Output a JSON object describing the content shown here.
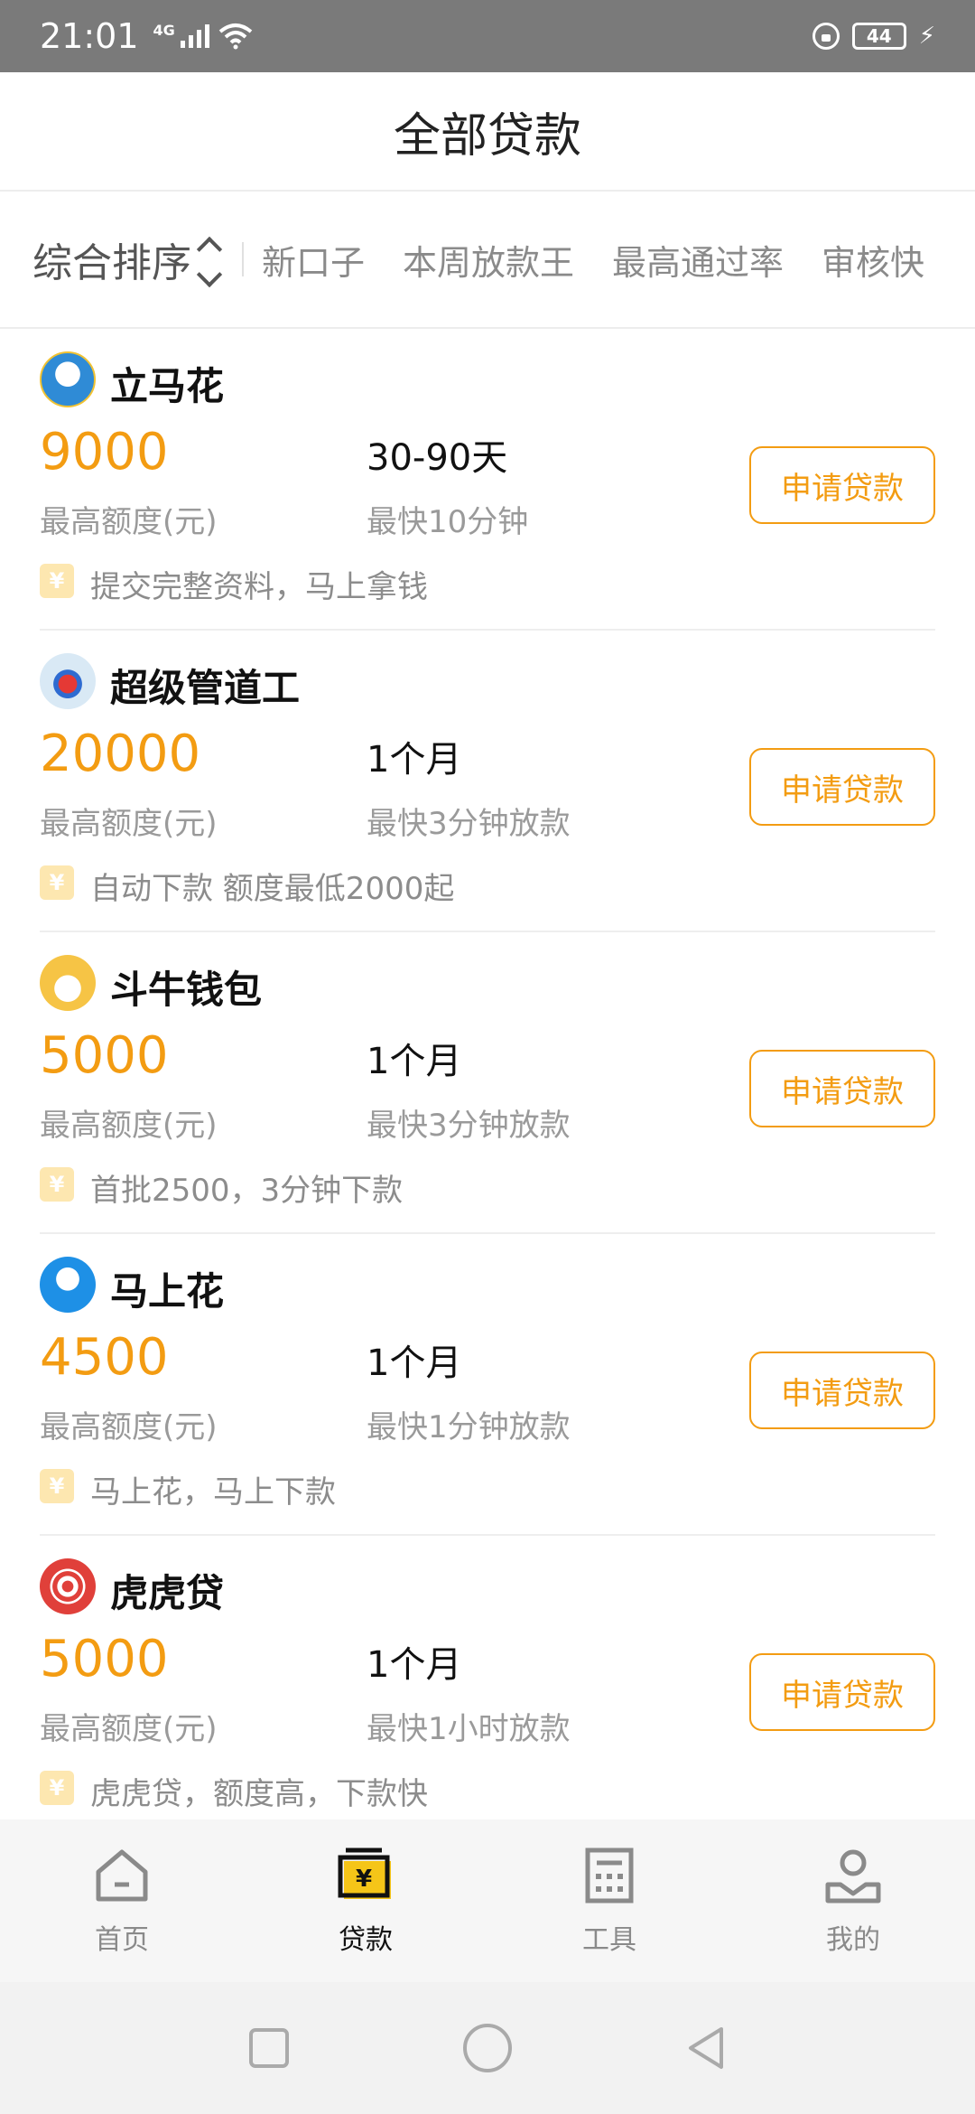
{
  "status_bar": {
    "time": "21:01",
    "network": "4G",
    "battery": "44"
  },
  "header": {
    "title": "全部贷款"
  },
  "filters": {
    "sort_label": "综合排序",
    "tabs": [
      "新口子",
      "本周放款王",
      "最高通过率",
      "审核快"
    ]
  },
  "loans": [
    {
      "name": "立马花",
      "amount": "9000",
      "amount_label": "最高额度(元)",
      "term": "30-90天",
      "speed": "最快10分钟",
      "button": "申请贷款",
      "tag": "提交完整资料，马上拿钱",
      "tag_icon": "¥",
      "logo_icon": "horse-logo-icon",
      "logo_color": "#2f8bd6"
    },
    {
      "name": "超级管道工",
      "amount": "20000",
      "amount_label": "最高额度(元)",
      "term": "1个月",
      "speed": "最快3分钟放款",
      "button": "申请贷款",
      "tag": "自动下款 额度最低2000起",
      "tag_icon": "¥",
      "logo_icon": "mario-logo-icon",
      "logo_color": "#d9e9f5"
    },
    {
      "name": "斗牛钱包",
      "amount": "5000",
      "amount_label": "最高额度(元)",
      "term": "1个月",
      "speed": "最快3分钟放款",
      "button": "申请贷款",
      "tag": "首批2500，3分钟下款",
      "tag_icon": "¥",
      "logo_icon": "cow-logo-icon",
      "logo_color": "#f6c445"
    },
    {
      "name": "马上花",
      "amount": "4500",
      "amount_label": "最高额度(元)",
      "term": "1个月",
      "speed": "最快1分钟放款",
      "button": "申请贷款",
      "tag": "马上花，马上下款",
      "tag_icon": "¥",
      "logo_icon": "horse-logo-icon",
      "logo_color": "#1e90e6"
    },
    {
      "name": "虎虎贷",
      "amount": "5000",
      "amount_label": "最高额度(元)",
      "term": "1个月",
      "speed": "最快1小时放款",
      "button": "申请贷款",
      "tag": "虎虎贷，额度高，下款快",
      "tag_icon": "¥",
      "logo_icon": "swirl-logo-icon",
      "logo_color": "#e0403a"
    }
  ],
  "bottom_nav": [
    {
      "label": "首页",
      "icon": "home-icon",
      "active": false
    },
    {
      "label": "贷款",
      "icon": "loan-icon",
      "active": true
    },
    {
      "label": "工具",
      "icon": "calculator-icon",
      "active": false
    },
    {
      "label": "我的",
      "icon": "profile-icon",
      "active": false
    }
  ],
  "colors": {
    "accent": "#f39c12",
    "active_nav": "#f5c518"
  }
}
